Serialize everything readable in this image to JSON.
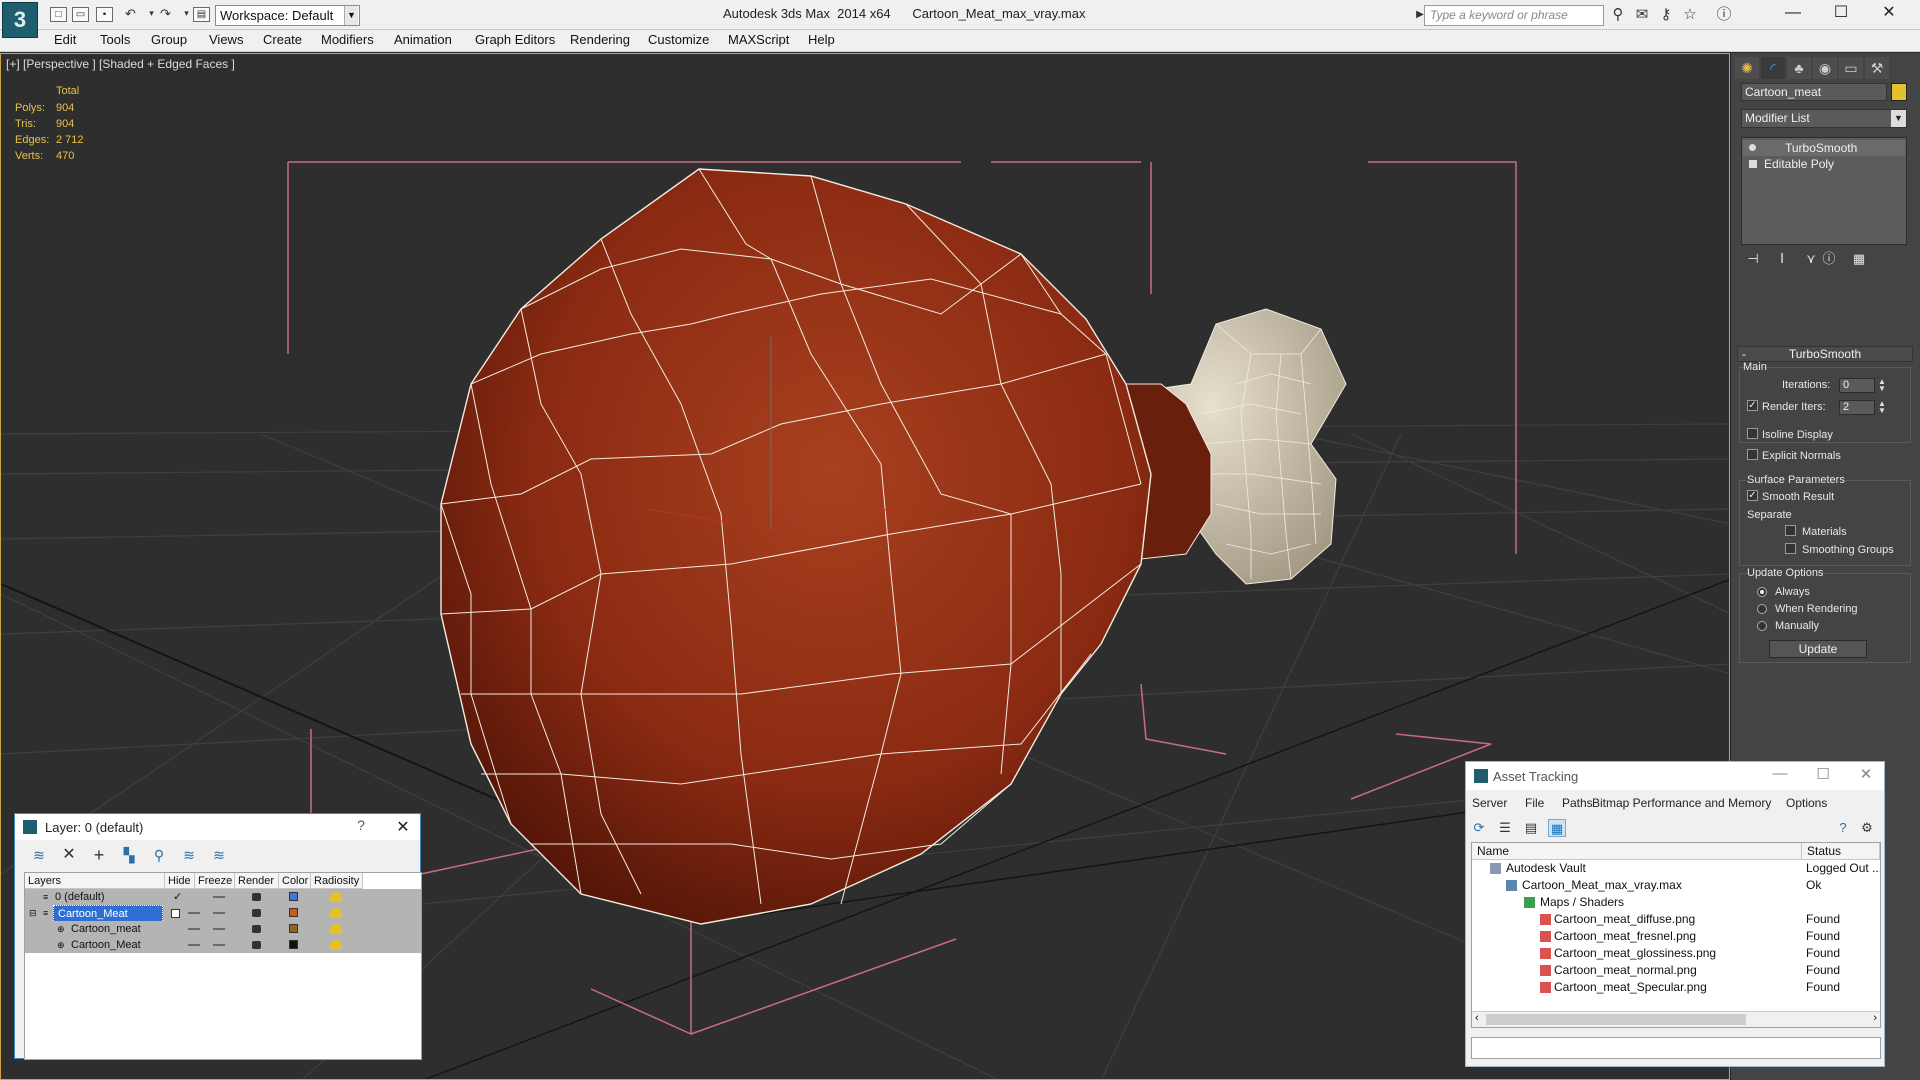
{
  "app": {
    "window_title": "Autodesk 3ds Max  2014 x64      Cartoon_Meat_max_vray.max",
    "workspace": "Workspace: Default",
    "search_placeholder": "Type a keyword or phrase"
  },
  "menu": [
    "Edit",
    "Tools",
    "Group",
    "Views",
    "Create",
    "Modifiers",
    "Animation",
    "Graph Editors",
    "Rendering",
    "Customize",
    "MAXScript",
    "Help"
  ],
  "viewport": {
    "label": "[+] [Perspective ] [Shaded + Edged Faces ]",
    "stats": {
      "header": "Total",
      "rows": [
        {
          "label": "Polys:",
          "value": "904"
        },
        {
          "label": "Tris:",
          "value": "904"
        },
        {
          "label": "Edges:",
          "value": "2 712"
        },
        {
          "label": "Verts:",
          "value": "470"
        }
      ]
    },
    "colors": {
      "meat": "#8a2a12",
      "bone": "#c9bfa8",
      "grid": "#3e3e3e",
      "bracket": "#c86b86"
    }
  },
  "command_panel": {
    "object_name": "Cartoon_meat",
    "object_color": "#e2c12a",
    "modifier_list": "Modifier List",
    "stack": [
      "TurboSmooth",
      "Editable Poly"
    ],
    "rollout": "TurboSmooth",
    "main_group": "Main",
    "iterations_label": "Iterations:",
    "iterations_value": "0",
    "render_iters_label": "Render Iters:",
    "render_iters_value": "2",
    "isoline": "Isoline Display",
    "explicit_normals": "Explicit Normals",
    "surface_group": "Surface Parameters",
    "smooth_result": "Smooth Result",
    "separate": "Separate",
    "materials": "Materials",
    "smoothing_groups": "Smoothing Groups",
    "update_group": "Update Options",
    "always": "Always",
    "when_rendering": "When Rendering",
    "manually": "Manually",
    "update_button": "Update"
  },
  "layer_dialog": {
    "title": "Layer: 0 (default)",
    "help": "?",
    "columns": [
      "Layers",
      "Hide",
      "Freeze",
      "Render",
      "Color",
      "Radiosity"
    ],
    "rows": [
      {
        "name": "0 (default)",
        "color": "#3b78d8"
      },
      {
        "name": "Cartoon_Meat",
        "color": "#c85a1a"
      },
      {
        "name": "Cartoon_meat",
        "color": "#8a6a10"
      },
      {
        "name": "Cartoon_Meat",
        "color": "#111111"
      }
    ]
  },
  "asset_dialog": {
    "title": "Asset Tracking",
    "menu": [
      "Server",
      "File",
      "Paths",
      "Bitmap Performance and Memory",
      "Options"
    ],
    "columns": [
      "Name",
      "Status"
    ],
    "rows": [
      {
        "name": "Autodesk Vault",
        "status": "Logged Out ..."
      },
      {
        "name": "Cartoon_Meat_max_vray.max",
        "status": "Ok"
      },
      {
        "name": "Maps / Shaders",
        "status": ""
      },
      {
        "name": "Cartoon_meat_diffuse.png",
        "status": "Found"
      },
      {
        "name": "Cartoon_meat_fresnel.png",
        "status": "Found"
      },
      {
        "name": "Cartoon_meat_glossiness.png",
        "status": "Found"
      },
      {
        "name": "Cartoon_meat_normal.png",
        "status": "Found"
      },
      {
        "name": "Cartoon_meat_Specular.png",
        "status": "Found"
      }
    ]
  }
}
